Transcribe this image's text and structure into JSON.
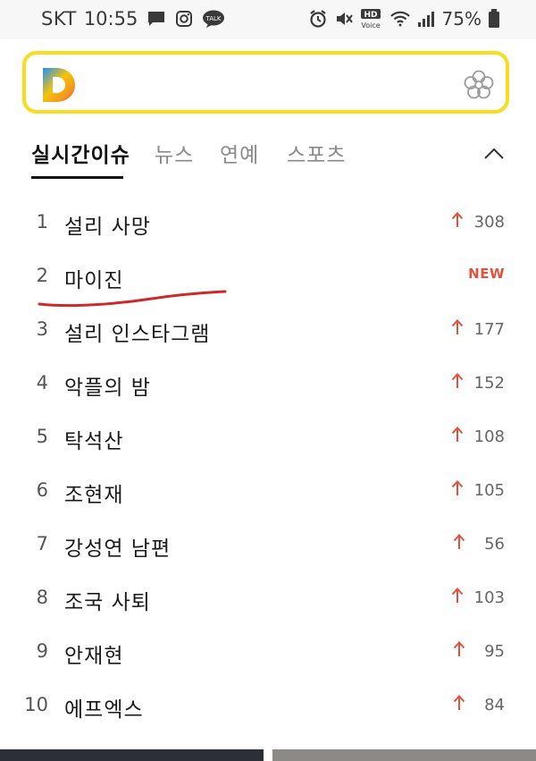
{
  "status_bar": {
    "carrier": "SKT",
    "time": "10:55",
    "battery": "75%",
    "hd_label_top": "HD",
    "hd_label_bottom": "Voice",
    "talk_label": "TALK"
  },
  "search": {
    "logo_letter": "D"
  },
  "tabs": [
    {
      "label": "실시간이슈",
      "active": true
    },
    {
      "label": "뉴스",
      "active": false
    },
    {
      "label": "연예",
      "active": false
    },
    {
      "label": "스포츠",
      "active": false
    }
  ],
  "rankings": [
    {
      "rank": "1",
      "term": "설리 사망",
      "change": "308",
      "new": false
    },
    {
      "rank": "2",
      "term": "마이진",
      "change": "NEW",
      "new": true
    },
    {
      "rank": "3",
      "term": "설리 인스타그램",
      "change": "177",
      "new": false
    },
    {
      "rank": "4",
      "term": "악플의 밤",
      "change": "152",
      "new": false
    },
    {
      "rank": "5",
      "term": "탁석산",
      "change": "108",
      "new": false
    },
    {
      "rank": "6",
      "term": "조현재",
      "change": "105",
      "new": false
    },
    {
      "rank": "7",
      "term": "강성연 남편",
      "change": "56",
      "new": false
    },
    {
      "rank": "8",
      "term": "조국 사퇴",
      "change": "103",
      "new": false
    },
    {
      "rank": "9",
      "term": "안재현",
      "change": "95",
      "new": false
    },
    {
      "rank": "10",
      "term": "에프엑스",
      "change": "84",
      "new": false
    }
  ],
  "colors": {
    "accent_yellow": "#f6de1f",
    "rise_red": "#e2523b",
    "annotation_red": "#cc2a2a"
  }
}
